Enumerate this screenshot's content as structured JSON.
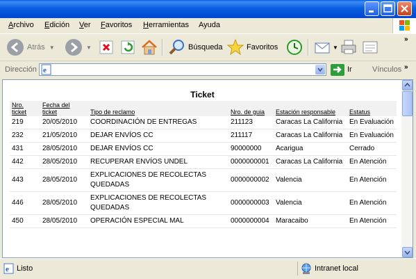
{
  "menu": {
    "items": [
      {
        "u": "A",
        "rest": "rchivo"
      },
      {
        "u": "E",
        "rest": "dición"
      },
      {
        "u": "V",
        "rest": "er"
      },
      {
        "u": "F",
        "rest": "avoritos"
      },
      {
        "u": "H",
        "rest": "erramientas"
      },
      {
        "u": "",
        "rest": "Ayuda"
      }
    ]
  },
  "toolbar": {
    "back_label": "Atrás",
    "search_label": "Búsqueda",
    "favorites_label": "Favoritos"
  },
  "address": {
    "label": "Dirección",
    "value": "",
    "go_label": "Ir",
    "links_label": "Vínculos"
  },
  "page": {
    "title": "Ticket",
    "headers": {
      "nro_ticket": [
        "Nro.",
        "ticket"
      ],
      "fecha": [
        "Fecha del",
        "ticket"
      ],
      "tipo": "Tipo de reclamo",
      "guia": "Nro. de guia",
      "estacion": "Estación responsable",
      "estatus": "Estatus"
    },
    "rows": [
      {
        "ticket": "219",
        "fecha": "20/05/2010",
        "tipo": "COORDINACIÓN DE ENTREGAS",
        "guia": "211123",
        "estacion": "Caracas La California",
        "estatus": "En Evaluación"
      },
      {
        "ticket": "232",
        "fecha": "21/05/2010",
        "tipo": "DEJAR ENVÍOS CC",
        "guia": "211117",
        "estacion": "Caracas La California",
        "estatus": "En Evaluación"
      },
      {
        "ticket": "431",
        "fecha": "28/05/2010",
        "tipo": "DEJAR ENVÍOS CC",
        "guia": "90000000",
        "estacion": "Acarigua",
        "estatus": "Cerrado"
      },
      {
        "ticket": "442",
        "fecha": "28/05/2010",
        "tipo": "RECUPERAR ENVÍOS UNDEL",
        "guia": "0000000001",
        "estacion": "Caracas La California",
        "estatus": "En Atención"
      },
      {
        "ticket": "443",
        "fecha": "28/05/2010",
        "tipo": "EXPLICACIONES DE RECOLECTAS QUEDADAS",
        "guia": "0000000002",
        "estacion": "Valencia",
        "estatus": "En Atención"
      },
      {
        "ticket": "446",
        "fecha": "28/05/2010",
        "tipo": "EXPLICACIONES DE RECOLECTAS QUEDADAS",
        "guia": "0000000003",
        "estacion": "Valencia",
        "estatus": "En Atención"
      },
      {
        "ticket": "450",
        "fecha": "28/05/2010",
        "tipo": "OPERACIÓN ESPECIAL MAL",
        "guia": "0000000004",
        "estacion": "Maracaibo",
        "estatus": "En Atención"
      }
    ]
  },
  "status": {
    "text": "Listo",
    "zone": "Intranet local"
  },
  "colors": {
    "titlebar": "#0a5fe0",
    "chrome": "#ece9d8"
  }
}
